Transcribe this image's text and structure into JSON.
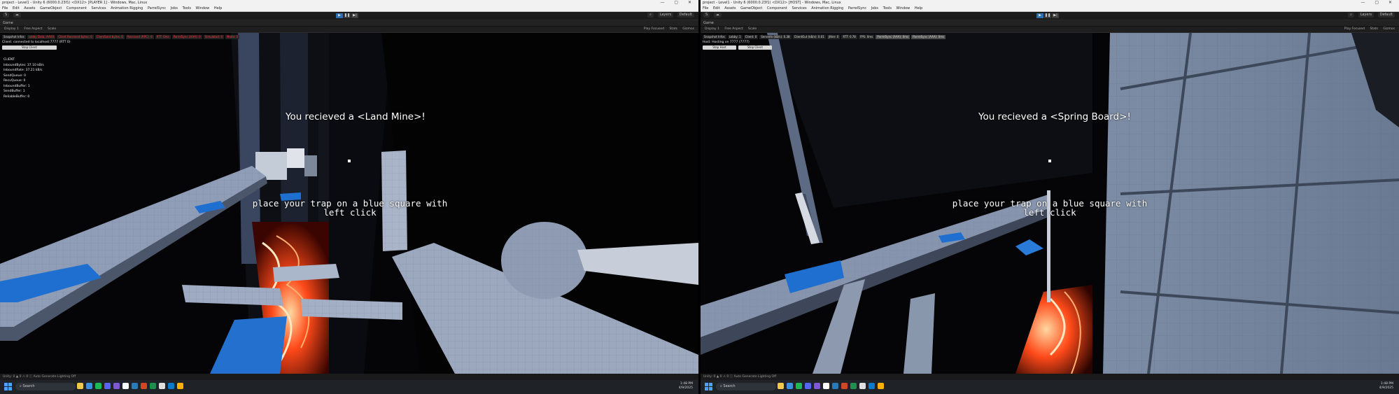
{
  "left": {
    "titlebar": "project - Level1 - Unity 6 (6000.0.23f1) <DX12> [PLAYER 1] - Windows, Mac, Linux",
    "menu": [
      "File",
      "Edit",
      "Assets",
      "GameObject",
      "Component",
      "Services",
      "Animation Rigging",
      "ParrelSync",
      "Jobs",
      "Tools",
      "Window",
      "Help"
    ],
    "toolbar": {
      "account": "S",
      "cloud": "",
      "layers": "Layers",
      "layout": "Default",
      "search": "Search"
    },
    "tab": "Game",
    "gamebar": {
      "display": "Game",
      "display_num": "Display 1",
      "aspect": "Free Aspect",
      "scale": "Scale",
      "play_focused": "Play Focused",
      "stats": "Stats",
      "gizmos": "Gizmos"
    },
    "snapshot_bar": [
      "Snapshot Infos",
      "Lobby Data: AAXX",
      "Client Received bytes: 0",
      "ClientSent bytes: 0",
      "Received (RPC): 0",
      "RTT: 0ms",
      "ParrelSync (AAA): 0",
      "Simulated: 0",
      "Mode: 0"
    ],
    "status_line": "Client: connected to localhost:7777 (RTT 0)",
    "buttons": [
      "Stop Client"
    ],
    "stats_title": "CLIENT",
    "stats": [
      "InboundBytes: 37.10 kB/s",
      "InboundRate: 37.21 kB/s",
      "SendQueue: 0",
      "RecvQueue: 0",
      "InboundBuffer: 1",
      "SendBuffer: 1",
      "ReliableBuffer: 0"
    ],
    "banner": "You recieved a <Land Mine>!",
    "hint": "place your trap on a blue square with left click",
    "bottombar": "Unity: 0 ▲ 0 ⚠ 0 ⓘ Auto Generate Lighting Off",
    "taskbar": {
      "search": "Search",
      "time": "1:48 PM",
      "date": "4/9/2025"
    }
  },
  "right": {
    "titlebar": "project - Level1 - Unity 6 (6000.0.23f1) <DX12> [HOST] - Windows, Mac, Linux",
    "menu": [
      "File",
      "Edit",
      "Assets",
      "GameObject",
      "Component",
      "Services",
      "Animation Rigging",
      "ParrelSync",
      "Jobs",
      "Tools",
      "Window",
      "Help"
    ],
    "toolbar": {
      "account": "S",
      "cloud": "",
      "layers": "Layers",
      "layout": "Default",
      "search": "Search"
    },
    "tab": "Game",
    "gamebar": {
      "display": "Game",
      "display_num": "Display 1",
      "aspect": "Free Aspect",
      "scale": "Scale",
      "play_focused": "Play Focused",
      "stats": "Stats",
      "gizmos": "Gizmos"
    },
    "snapshot_bar": [
      "Snapshot Infos",
      "Lobby: 1",
      "Client: 0",
      "ServerIn (kB/s): 0.38",
      "ClientOut (kB/s): 0.01",
      "Jitter: 0",
      "RTT: 0.78",
      "FPS: 0ms",
      "ParrelSync (AAA): 0ms",
      "ParrelSync (AAA): 0ms"
    ],
    "status_line": "Host: Hosting on 7777 (7777)",
    "buttons": [
      "Stop Host",
      "Stop Client"
    ],
    "banner": "You recieved a <Spring Board>!",
    "hint": "place your trap on a blue square with left click",
    "bottombar": "Unity: 0 ▲ 0 ⚠ 0 ⓘ Auto Generate Lighting Off",
    "taskbar": {
      "search": "Search",
      "time": "1:48 PM",
      "date": "4/9/2025"
    }
  },
  "colors": {
    "accent_blue": "#1a6fd0",
    "platform": "#8a9bb8",
    "lava": "#ff4a1a",
    "editor_bg": "#1b1b1b"
  }
}
